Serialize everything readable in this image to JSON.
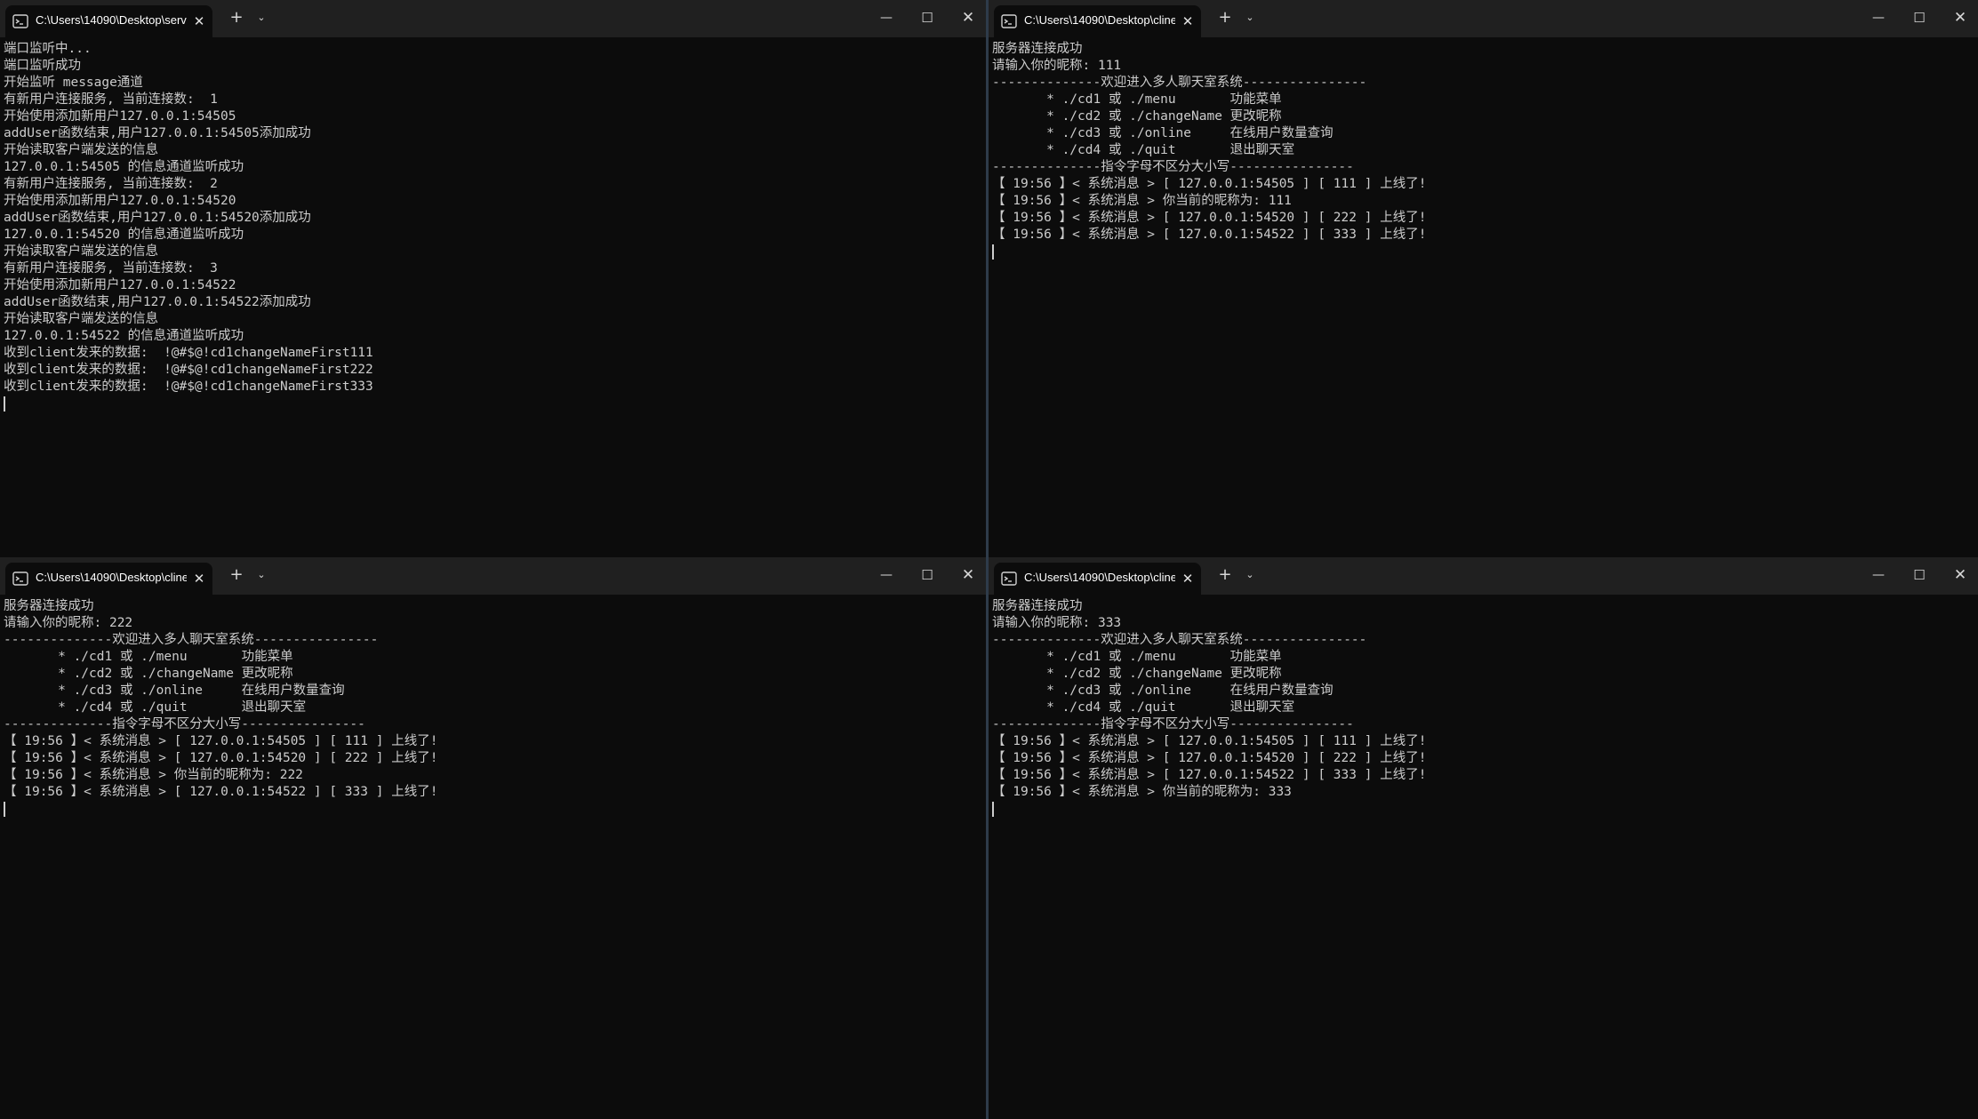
{
  "colors": {
    "terminal_bg": "#0c0c0c",
    "titlebar_bg": "#202020",
    "text": "#cccccc"
  },
  "windows": [
    {
      "tab_title": "C:\\Users\\14090\\Desktop\\serve",
      "icons": {
        "tab": "terminal-icon",
        "close_tab": "close-icon",
        "new_tab": "plus-icon",
        "dropdown": "chevron-down-icon",
        "minimize": "minimize-icon",
        "maximize": "maximize-icon",
        "close": "close-icon"
      },
      "lines": [
        "端口监听中...",
        "端口监听成功",
        "开始监听 message通道",
        "有新用户连接服务, 当前连接数:  1",
        "开始使用添加新用户127.0.0.1:54505",
        "addUser函数结束,用户127.0.0.1:54505添加成功",
        "开始读取客户端发送的信息",
        "127.0.0.1:54505 的信息通道监听成功",
        "有新用户连接服务, 当前连接数:  2",
        "开始使用添加新用户127.0.0.1:54520",
        "addUser函数结束,用户127.0.0.1:54520添加成功",
        "127.0.0.1:54520 的信息通道监听成功",
        "开始读取客户端发送的信息",
        "有新用户连接服务, 当前连接数:  3",
        "开始使用添加新用户127.0.0.1:54522",
        "addUser函数结束,用户127.0.0.1:54522添加成功",
        "开始读取客户端发送的信息",
        "127.0.0.1:54522 的信息通道监听成功",
        "收到client发来的数据:  !@#$@!cd1changeNameFirst111",
        "收到client发来的数据:  !@#$@!cd1changeNameFirst222",
        "收到client发来的数据:  !@#$@!cd1changeNameFirst333"
      ]
    },
    {
      "tab_title": "C:\\Users\\14090\\Desktop\\cline",
      "lines": [
        "服务器连接成功",
        "请输入你的昵称: 111",
        "--------------欢迎进入多人聊天室系统----------------",
        "       * ./cd1 或 ./menu       功能菜单",
        "       * ./cd2 或 ./changeName 更改昵称",
        "       * ./cd3 或 ./online     在线用户数量查询",
        "       * ./cd4 或 ./quit       退出聊天室",
        "--------------指令字母不区分大小写----------------",
        "【 19:56 】< 系统消息 > [ 127.0.0.1:54505 ] [ 111 ] 上线了!",
        "【 19:56 】< 系统消息 > 你当前的昵称为: 111",
        "【 19:56 】< 系统消息 > [ 127.0.0.1:54520 ] [ 222 ] 上线了!",
        "【 19:56 】< 系统消息 > [ 127.0.0.1:54522 ] [ 333 ] 上线了!"
      ]
    },
    {
      "tab_title": "C:\\Users\\14090\\Desktop\\cline",
      "lines": [
        "服务器连接成功",
        "请输入你的昵称: 222",
        "--------------欢迎进入多人聊天室系统----------------",
        "       * ./cd1 或 ./menu       功能菜单",
        "       * ./cd2 或 ./changeName 更改昵称",
        "       * ./cd3 或 ./online     在线用户数量查询",
        "       * ./cd4 或 ./quit       退出聊天室",
        "--------------指令字母不区分大小写----------------",
        "【 19:56 】< 系统消息 > [ 127.0.0.1:54505 ] [ 111 ] 上线了!",
        "【 19:56 】< 系统消息 > [ 127.0.0.1:54520 ] [ 222 ] 上线了!",
        "【 19:56 】< 系统消息 > 你当前的昵称为: 222",
        "【 19:56 】< 系统消息 > [ 127.0.0.1:54522 ] [ 333 ] 上线了!"
      ]
    },
    {
      "tab_title": "C:\\Users\\14090\\Desktop\\cline",
      "lines": [
        "服务器连接成功",
        "请输入你的昵称: 333",
        "--------------欢迎进入多人聊天室系统----------------",
        "       * ./cd1 或 ./menu       功能菜单",
        "       * ./cd2 或 ./changeName 更改昵称",
        "       * ./cd3 或 ./online     在线用户数量查询",
        "       * ./cd4 或 ./quit       退出聊天室",
        "--------------指令字母不区分大小写----------------",
        "【 19:56 】< 系统消息 > [ 127.0.0.1:54505 ] [ 111 ] 上线了!",
        "【 19:56 】< 系统消息 > [ 127.0.0.1:54520 ] [ 222 ] 上线了!",
        "【 19:56 】< 系统消息 > [ 127.0.0.1:54522 ] [ 333 ] 上线了!",
        "【 19:56 】< 系统消息 > 你当前的昵称为: 333"
      ]
    }
  ]
}
